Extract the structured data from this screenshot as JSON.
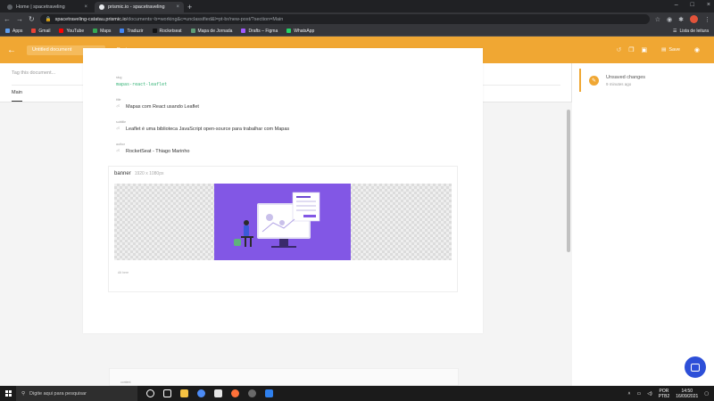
{
  "browser": {
    "tabs": [
      {
        "title": "Home | spacetraveling"
      },
      {
        "title": "prismic.io - spacetraveling"
      }
    ],
    "url_host": "spacetraveling-catatau.prismic.io",
    "url_path": "/documents~b=working&c=unclassified&l=pt-br/new-post/?section=Main",
    "bookmarks": [
      "Apps",
      "Gmail",
      "YouTube",
      "Maps",
      "Traduzir",
      "Rocketseat",
      "Mapa de Jornada",
      "Drafts – Figma",
      "WhatsApp"
    ],
    "reading_list": "Lista de leitura"
  },
  "header": {
    "document_title": "Untitled document",
    "doc_type": "Post",
    "save_label": "Save"
  },
  "editor": {
    "tag_placeholder": "Tag this document...",
    "section_tab": "Main",
    "fields": {
      "slug_label": "slug",
      "slug_value": "mapas-react-leaflet",
      "title_label": "title",
      "title_value": "Mapas com React usando Leaflet",
      "subtitle_label": "subtitle",
      "subtitle_value": "Leaflet é uma biblioteca JavaScript open-source para trabalhar com Mapas",
      "author_label": "author",
      "author_value": "RocketSeat - Thiago Marinho"
    },
    "banner": {
      "label": "banner",
      "size": "1920 x 1080px",
      "alt_placeholder": "Alt here"
    },
    "next_field_label": "content"
  },
  "side_panel": {
    "status_title": "Unsaved changes",
    "status_time": "9 minutes ago"
  },
  "taskbar": {
    "search_placeholder": "Digite aqui para pesquisar",
    "lang1": "POR",
    "lang2": "PTB2",
    "time": "14:50",
    "date": "16/09/2021"
  },
  "colors": {
    "accent": "#f0a733",
    "banner_purple": "#8257e5",
    "chat": "#2d4fd8"
  }
}
